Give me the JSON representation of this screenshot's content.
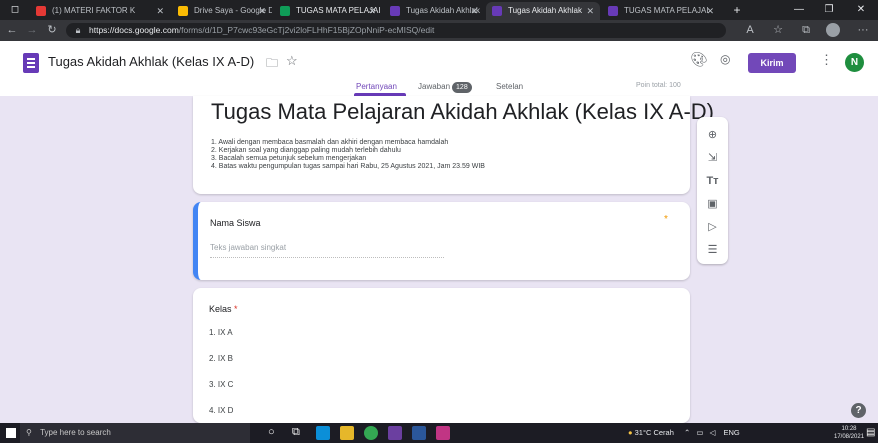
{
  "browser": {
    "tabs": [
      {
        "label": "(1) MATERI FAKTOR K",
        "fav_color": "#e53935"
      },
      {
        "label": "Drive Saya - Google D",
        "fav_color": "#fbbc04"
      },
      {
        "label": "TUGAS MATA PELAJAI",
        "fav_color": "#0f9d58"
      },
      {
        "label": "Tugas Akidah Akhlak",
        "fav_color": "#673ab7"
      },
      {
        "label": "Tugas Akidah Akhlak",
        "fav_color": "#673ab7"
      },
      {
        "label": "TUGAS MATA PELAJAI",
        "fav_color": "#673ab7"
      }
    ],
    "new_tab": "+",
    "url_host": "https://docs.google.com",
    "url_path": "/forms/d/1D_P7cwc93eGcTj2vi2loFLHhF15BjZOpNniP-ecMISQ/edit"
  },
  "header": {
    "doc_title": "Tugas Akidah Akhlak (Kelas IX A-D)",
    "send_label": "Kirim",
    "avatar_letter": "N",
    "tabs": {
      "questions": "Pertanyaan",
      "responses": "Jawaban",
      "responses_count": "128",
      "settings": "Setelan"
    },
    "total_points": "Poin total: 100"
  },
  "form": {
    "title": "Tugas Mata Pelajaran Akidah Akhlak (Kelas IX A-D)",
    "instructions": [
      "1. Awali dengan membaca basmalah dan akhiri dengan membaca hamdalah",
      "2. Kerjakan soal yang dianggap paling mudah terlebih dahulu",
      "3. Bacalah semua petunjuk sebelum mengerjakan",
      "4. Batas waktu pengumpulan tugas sampai hari Rabu, 25 Agustus 2021, Jam 23.59 WIB"
    ],
    "q1": {
      "label": "Nama Siswa",
      "placeholder": "Teks jawaban singkat",
      "required_mark": "*"
    },
    "q2": {
      "label": "Kelas",
      "required_mark": "*",
      "options": [
        "1.  IX A",
        "2.  IX B",
        "3.  IX C",
        "4.  IX D"
      ]
    }
  },
  "taskbar": {
    "search_placeholder": "Type here to search",
    "weather": "31°C  Cerah",
    "language": "ENG",
    "time": "10:28",
    "date": "17/08/2021"
  },
  "colors": {
    "accent": "#673ab7",
    "send_button": "#7248b9",
    "focus_bar": "#4285f4",
    "background": "#e9e4f3"
  }
}
